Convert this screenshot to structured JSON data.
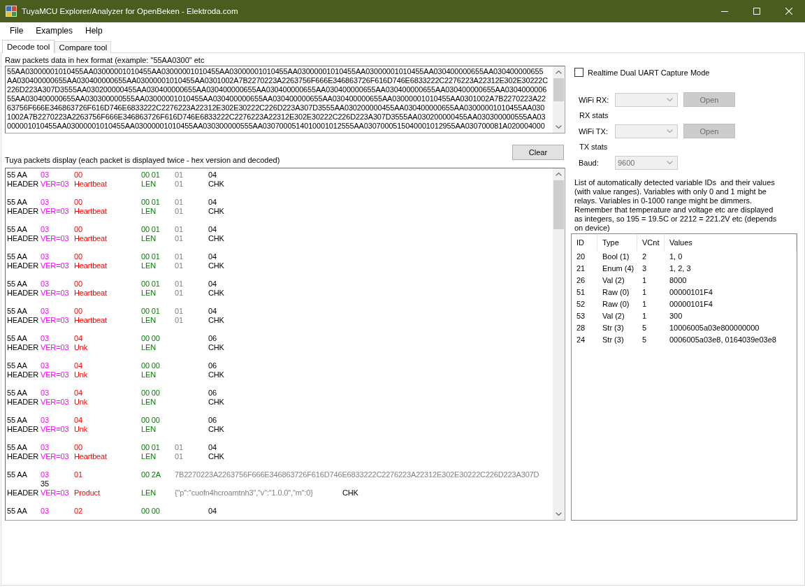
{
  "window": {
    "title": "TuyaMCU Explorer/Analyzer for OpenBeken - Elektroda.com"
  },
  "menu": [
    "File",
    "Examples",
    "Help"
  ],
  "tabs": [
    {
      "label": "Decode tool",
      "selected": true
    },
    {
      "label": "Compare tool",
      "selected": false
    }
  ],
  "raw_input": {
    "label": "Raw packets data in hex format (example: \"55AA0300\" etc",
    "lines": [
      "55AA03000001010455AA03000001010455AA03000001010455AA03000001010455AA03000001010455AA03000001010455AA030400000655AA030400000655",
      "AA030400000655AA030400000655AA03000001010455AA0301002A7B2270223A2263756F666E346863726F616D746E6833222C2276223A22312E302E30222C",
      "226D223A307D3555AA030200000455AA030400000655AA030400000655AA030400000655AA030400000655AA030400000655AA030400000655AA0304000006",
      "55AA030400000655AA030300000555AA03000001010455AA030400000655AA030400000655AA030400000655AA03000001010455AA0301002A7B2270223A22",
      "63756F666E346863726F616D746E6833222C2276223A22312E302E30222C226D223A307D3555AA030200000455AA030400000655AA03000001010455AA030",
      "1002A7B2270223A2263756F666E346863726F616D746E6833222C2276223A22312E302E30222C226D223A307D3555AA030200000455AA030300000555AA03",
      "000001010455AA03000001010455AA03000001010455AA030300000555AA0307000514010001012555AA0307000515040001012955AA030700081A020004000"
    ]
  },
  "packets_panel": {
    "label": "Tuya packets display (each packet is displayed twice - hex version and decoded)",
    "clear_button": {
      "label": "Clear",
      "disabled": false
    },
    "packets": [
      {
        "cells": [
          {
            "kind": "header",
            "hex": "55 AA",
            "label": "HEADER"
          },
          {
            "kind": "version",
            "hex": "03",
            "label": "VER=03"
          },
          {
            "kind": "command",
            "hex": "00",
            "label": "Heartbeat"
          },
          {
            "kind": "length",
            "hex": "00 01",
            "label": "LEN"
          },
          {
            "kind": "data",
            "hex": "01",
            "label": "01"
          },
          {
            "kind": "checksum",
            "hex": "04",
            "label": "CHK"
          }
        ]
      },
      {
        "cells": [
          {
            "kind": "header",
            "hex": "55 AA",
            "label": "HEADER"
          },
          {
            "kind": "version",
            "hex": "03",
            "label": "VER=03"
          },
          {
            "kind": "command",
            "hex": "00",
            "label": "Heartbeat"
          },
          {
            "kind": "length",
            "hex": "00 01",
            "label": "LEN"
          },
          {
            "kind": "data",
            "hex": "01",
            "label": "01"
          },
          {
            "kind": "checksum",
            "hex": "04",
            "label": "CHK"
          }
        ]
      },
      {
        "cells": [
          {
            "kind": "header",
            "hex": "55 AA",
            "label": "HEADER"
          },
          {
            "kind": "version",
            "hex": "03",
            "label": "VER=03"
          },
          {
            "kind": "command",
            "hex": "00",
            "label": "Heartbeat"
          },
          {
            "kind": "length",
            "hex": "00 01",
            "label": "LEN"
          },
          {
            "kind": "data",
            "hex": "01",
            "label": "01"
          },
          {
            "kind": "checksum",
            "hex": "04",
            "label": "CHK"
          }
        ]
      },
      {
        "cells": [
          {
            "kind": "header",
            "hex": "55 AA",
            "label": "HEADER"
          },
          {
            "kind": "version",
            "hex": "03",
            "label": "VER=03"
          },
          {
            "kind": "command",
            "hex": "00",
            "label": "Heartbeat"
          },
          {
            "kind": "length",
            "hex": "00 01",
            "label": "LEN"
          },
          {
            "kind": "data",
            "hex": "01",
            "label": "01"
          },
          {
            "kind": "checksum",
            "hex": "04",
            "label": "CHK"
          }
        ]
      },
      {
        "cells": [
          {
            "kind": "header",
            "hex": "55 AA",
            "label": "HEADER"
          },
          {
            "kind": "version",
            "hex": "03",
            "label": "VER=03"
          },
          {
            "kind": "command",
            "hex": "00",
            "label": "Heartbeat"
          },
          {
            "kind": "length",
            "hex": "00 01",
            "label": "LEN"
          },
          {
            "kind": "data",
            "hex": "01",
            "label": "01"
          },
          {
            "kind": "checksum",
            "hex": "04",
            "label": "CHK"
          }
        ]
      },
      {
        "cells": [
          {
            "kind": "header",
            "hex": "55 AA",
            "label": "HEADER"
          },
          {
            "kind": "version",
            "hex": "03",
            "label": "VER=03"
          },
          {
            "kind": "command",
            "hex": "00",
            "label": "Heartbeat"
          },
          {
            "kind": "length",
            "hex": "00 01",
            "label": "LEN"
          },
          {
            "kind": "data",
            "hex": "01",
            "label": "01"
          },
          {
            "kind": "checksum",
            "hex": "04",
            "label": "CHK"
          }
        ]
      },
      {
        "cells": [
          {
            "kind": "header",
            "hex": "55 AA",
            "label": "HEADER"
          },
          {
            "kind": "version",
            "hex": "03",
            "label": "VER=03"
          },
          {
            "kind": "command",
            "hex": "04",
            "label": "Unk"
          },
          {
            "kind": "length",
            "hex": "00 00",
            "label": "LEN"
          },
          {
            "kind": "checksum",
            "hex": "06",
            "label": "CHK"
          }
        ]
      },
      {
        "cells": [
          {
            "kind": "header",
            "hex": "55 AA",
            "label": "HEADER"
          },
          {
            "kind": "version",
            "hex": "03",
            "label": "VER=03"
          },
          {
            "kind": "command",
            "hex": "04",
            "label": "Unk"
          },
          {
            "kind": "length",
            "hex": "00 00",
            "label": "LEN"
          },
          {
            "kind": "checksum",
            "hex": "06",
            "label": "CHK"
          }
        ]
      },
      {
        "cells": [
          {
            "kind": "header",
            "hex": "55 AA",
            "label": "HEADER"
          },
          {
            "kind": "version",
            "hex": "03",
            "label": "VER=03"
          },
          {
            "kind": "command",
            "hex": "04",
            "label": "Unk"
          },
          {
            "kind": "length",
            "hex": "00 00",
            "label": "LEN"
          },
          {
            "kind": "checksum",
            "hex": "06",
            "label": "CHK"
          }
        ]
      },
      {
        "cells": [
          {
            "kind": "header",
            "hex": "55 AA",
            "label": "HEADER"
          },
          {
            "kind": "version",
            "hex": "03",
            "label": "VER=03"
          },
          {
            "kind": "command",
            "hex": "04",
            "label": "Unk"
          },
          {
            "kind": "length",
            "hex": "00 00",
            "label": "LEN"
          },
          {
            "kind": "checksum",
            "hex": "06",
            "label": "CHK"
          }
        ]
      },
      {
        "cells": [
          {
            "kind": "header",
            "hex": "55 AA",
            "label": "HEADER"
          },
          {
            "kind": "version",
            "hex": "03",
            "label": "VER=03"
          },
          {
            "kind": "command",
            "hex": "00",
            "label": "Heartbeat"
          },
          {
            "kind": "length",
            "hex": "00 01",
            "label": "LEN"
          },
          {
            "kind": "data",
            "hex": "01",
            "label": "01"
          },
          {
            "kind": "checksum",
            "hex": "04",
            "label": "CHK"
          }
        ]
      },
      {
        "cells": [
          {
            "kind": "header",
            "hex": "55 AA",
            "label": "HEADER"
          },
          {
            "kind": "version",
            "hex": "03",
            "label": "VER=03"
          },
          {
            "kind": "command",
            "hex": "01",
            "label": "Product"
          },
          {
            "kind": "length",
            "hex": "00 2A",
            "label": "LEN"
          },
          {
            "kind": "data",
            "hex": "7B2270223A2263756F666E346863726F616D746E6833222C2276223A22312E302E30222C226D223A307D",
            "label": "{\"p\":\"cuofn4hcroamtnh3\",\"v\":\"1.0.0\",\"m\":0}"
          },
          {
            "kind": "checksum",
            "hex": "35",
            "label": "CHK"
          }
        ]
      },
      {
        "cells": [
          {
            "kind": "header",
            "hex": "55 AA"
          },
          {
            "kind": "version",
            "hex": "03"
          },
          {
            "kind": "command",
            "hex": "02"
          },
          {
            "kind": "length",
            "hex": "00 00"
          },
          {
            "kind": "checksum",
            "hex": "04"
          }
        ]
      }
    ]
  },
  "capture": {
    "checkbox": {
      "label": "Realtime Dual UART Capture Mode",
      "checked": false
    },
    "rows": [
      {
        "kind": "port",
        "label": "WiFi RX:",
        "dropdown": {
          "disabled": true
        },
        "button": {
          "label": "Open",
          "disabled": true
        }
      },
      {
        "kind": "stats",
        "label": "RX stats"
      },
      {
        "kind": "port",
        "label": "WiFi TX:",
        "dropdown": {
          "disabled": true
        },
        "button": {
          "label": "Open",
          "disabled": true
        }
      },
      {
        "kind": "stats",
        "label": "TX stats"
      },
      {
        "kind": "select",
        "label": "Baud:",
        "dropdown": {
          "value": "9600",
          "disabled": true
        }
      }
    ]
  },
  "variables": {
    "note": "List of automatically detected variable IDs  and their values (with value ranges). Variables with only 0 and 1 might be relays. Variables in 0-1000 range might be dimmers. Remember that temperature and voltage etc are displayed as integers, so 195 = 19.5C or 2212 = 221.2V etc (depends on device)",
    "columns": [
      "ID",
      "Type",
      "VCnt",
      "Values"
    ],
    "rows": [
      [
        "20",
        "Bool (1)",
        "2",
        "1, 0"
      ],
      [
        "21",
        "Enum (4)",
        "3",
        "1, 2, 3"
      ],
      [
        "26",
        "Val (2)",
        "1",
        "8000"
      ],
      [
        "51",
        "Raw (0)",
        "1",
        "00000101F4"
      ],
      [
        "52",
        "Raw (0)",
        "1",
        "00000101F4"
      ],
      [
        "53",
        "Val (2)",
        "1",
        "300"
      ],
      [
        "28",
        "Str (3)",
        "5",
        "10006005a03e800000000"
      ],
      [
        "24",
        "Str (3)",
        "5",
        "0006005a03e8, 0164039e03e8"
      ]
    ]
  }
}
